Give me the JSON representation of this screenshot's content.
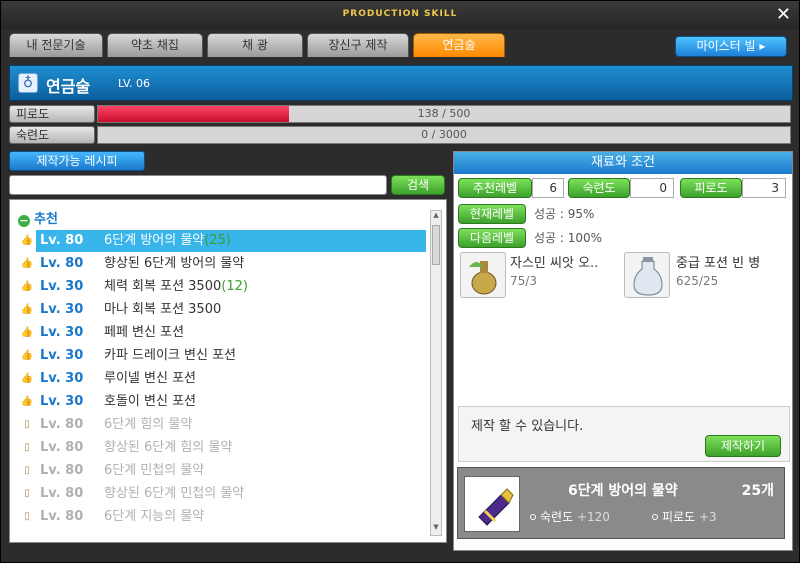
{
  "title": "PRODUCTION SKILL",
  "tabs": [
    "내 전문기술",
    "약초 채집",
    "채 광",
    "장신구 제작",
    "연금술"
  ],
  "master_button": "마이스터 빌 ▸",
  "skill": {
    "name": "연금술",
    "level": "LV. 06"
  },
  "fatigue": {
    "label": "피로도",
    "text": "138 / 500",
    "fraction": 0.276
  },
  "mastery": {
    "label": "숙련도",
    "text": "0 / 3000",
    "fraction": 0
  },
  "recipe_tab": "제작가능 레시피",
  "search": {
    "value": "",
    "button": "검색"
  },
  "category": "추천",
  "recipes": [
    {
      "lv": "Lv. 80",
      "name": "6단계 방어의 물약",
      "count": "(25)",
      "state": "selected"
    },
    {
      "lv": "Lv. 80",
      "name": "향상된 6단계 방어의 물약",
      "count": "",
      "state": "available"
    },
    {
      "lv": "Lv. 30",
      "name": "체력 회복 포션 3500",
      "count": "(12)",
      "state": "available"
    },
    {
      "lv": "Lv. 30",
      "name": "마나 회복 포션 3500",
      "count": "",
      "state": "available"
    },
    {
      "lv": "Lv. 30",
      "name": "페페 변신 포션",
      "count": "",
      "state": "available"
    },
    {
      "lv": "Lv. 30",
      "name": "카파 드레이크 변신 포션",
      "count": "",
      "state": "available"
    },
    {
      "lv": "Lv. 30",
      "name": "루이넬 변신 포션",
      "count": "",
      "state": "available"
    },
    {
      "lv": "Lv. 30",
      "name": "호돌이 변신 포션",
      "count": "",
      "state": "available"
    },
    {
      "lv": "Lv. 80",
      "name": "6단계 힘의 물약",
      "count": "",
      "state": "disabled"
    },
    {
      "lv": "Lv. 80",
      "name": "향상된 6단계 힘의 물약",
      "count": "",
      "state": "disabled"
    },
    {
      "lv": "Lv. 80",
      "name": "6단계 민첩의 물약",
      "count": "",
      "state": "disabled"
    },
    {
      "lv": "Lv. 80",
      "name": "향상된 6단계 민첩의 물약",
      "count": "",
      "state": "disabled"
    },
    {
      "lv": "Lv. 80",
      "name": "6단계 지능의 물약",
      "count": "",
      "state": "disabled"
    }
  ],
  "conditions": {
    "header": "재료와 조건",
    "rec_level_label": "추천레벨",
    "rec_level": "6",
    "mastery_label": "숙련도",
    "mastery": "0",
    "fatigue_label": "피로도",
    "fatigue": "3",
    "current_level_label": "현재레벨",
    "current_level_text": "성공 : 95%",
    "next_level_label": "다음레벨",
    "next_level_text": "성공 : 100%"
  },
  "materials": [
    {
      "name": "자스민 씨앗 오..",
      "qty": "75/3",
      "icon": "seed-oil-icon"
    },
    {
      "name": "중급 포션 빈 병",
      "qty": "625/25",
      "icon": "empty-bottle-icon"
    }
  ],
  "craft": {
    "message": "제작 할 수 있습니다.",
    "button": "제작하기"
  },
  "result": {
    "name": "6단계 방어의 물약",
    "count": "25개",
    "mastery_label": "숙련도",
    "mastery_value": "+120",
    "fatigue_label": "피로도",
    "fatigue_value": "+3"
  },
  "colors": {
    "accent": "#1a78cc",
    "active_tab": "#ff8a00",
    "green_button": "#3ca12c",
    "fatigue_bar": "#c8102e"
  }
}
